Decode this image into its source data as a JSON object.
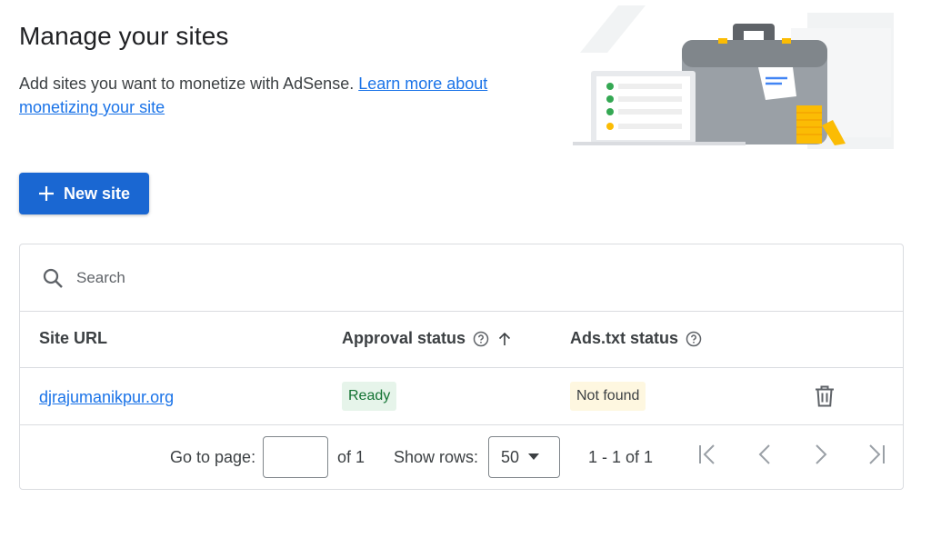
{
  "page": {
    "title": "Manage your sites",
    "description": "Add sites you want to monetize with AdSense. ",
    "learn_more_link": "Learn more about monetizing your site",
    "new_site_button": "New site"
  },
  "search": {
    "placeholder": "Search"
  },
  "table": {
    "columns": [
      "Site URL",
      "Approval status",
      "Ads.txt status"
    ],
    "rows": [
      {
        "site_url": "djrajumanikpur.org",
        "approval_status": "Ready",
        "ads_txt_status": "Not found"
      }
    ]
  },
  "pagination": {
    "go_to_page_label": "Go to page:",
    "page_value": "",
    "of_pages": "of 1",
    "show_rows_label": "Show rows:",
    "rows_per_page": "50",
    "range_text": "1 - 1 of 1"
  },
  "colors": {
    "primary_button": "#1a67d2",
    "link": "#1a73e8",
    "ready_badge_bg": "#e6f4ea",
    "ready_badge_text": "#137333",
    "notfound_badge_bg": "#fef7e0"
  },
  "icons": {
    "add": "plus-icon",
    "search": "search-icon",
    "help": "help-circle-icon",
    "sort": "arrow-up-icon",
    "delete": "trash-icon",
    "dropdown": "caret-down-icon",
    "first_page": "first-page-icon",
    "prev_page": "chevron-left-icon",
    "next_page": "chevron-right-icon",
    "last_page": "last-page-icon"
  }
}
